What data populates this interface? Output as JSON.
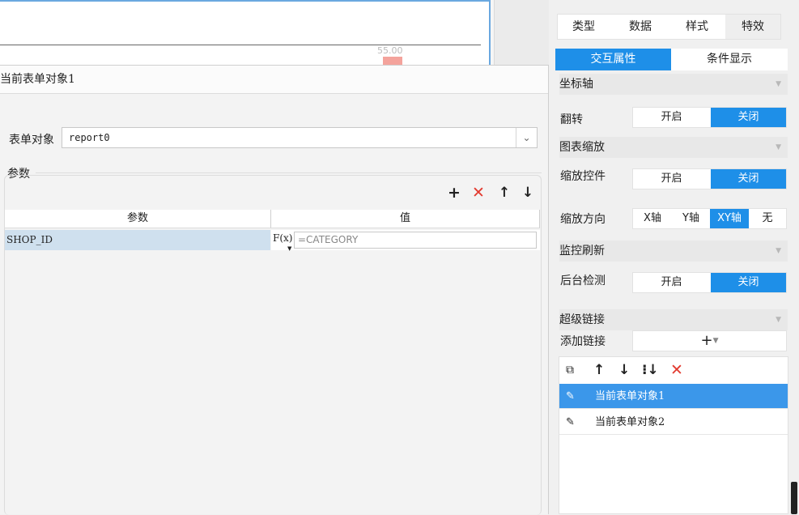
{
  "chart": {
    "value_label": "55.00"
  },
  "dialog": {
    "title": "当前表单对象1",
    "form_object_label": "表单对象",
    "form_object_value": "report0",
    "params_group_label": "参数",
    "table": {
      "col_param": "参数",
      "col_value": "值",
      "rows": [
        {
          "param": "SHOP_ID",
          "fx": "F(x)",
          "value": "=CATEGORY"
        }
      ]
    }
  },
  "panel": {
    "tabs": [
      "类型",
      "数据",
      "样式",
      "特效"
    ],
    "subtabs": [
      "交互属性",
      "条件显示"
    ],
    "sections": {
      "axis": "坐标轴",
      "zoom": "图表缩放",
      "monitor": "监控刷新",
      "hyperlink": "超级链接"
    },
    "rows": {
      "flip": "翻转",
      "zoom_control": "缩放控件",
      "zoom_direction": "缩放方向",
      "background_check": "后台检测",
      "add_link": "添加链接"
    },
    "toggle": {
      "on": "开启",
      "off": "关闭"
    },
    "direction": [
      "X轴",
      "Y轴",
      "XY轴",
      "无"
    ],
    "links": [
      "当前表单对象1",
      "当前表单对象2"
    ],
    "accent_color": "#1e8fe8"
  }
}
